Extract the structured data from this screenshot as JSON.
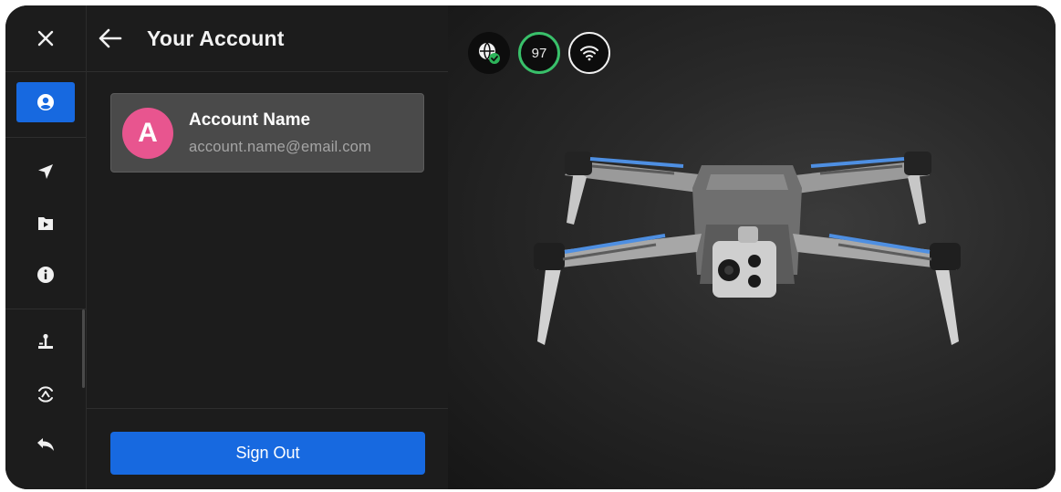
{
  "header": {
    "title": "Your Account"
  },
  "account": {
    "initial": "A",
    "name": "Account Name",
    "email": "account.name@email.com"
  },
  "actions": {
    "sign_out": "Sign Out"
  },
  "status": {
    "battery_percent": "97"
  },
  "rail": {
    "icons": [
      "close-icon",
      "account-icon",
      "navigation-arrow-icon",
      "media-folder-icon",
      "info-icon",
      "joystick-icon",
      "return-home-icon",
      "undo-icon"
    ],
    "active": "account-icon"
  },
  "colors": {
    "accent": "#1769e0",
    "avatar": "#e8558f",
    "battery_ring": "#39c06a",
    "globe_check": "#2db45a"
  }
}
